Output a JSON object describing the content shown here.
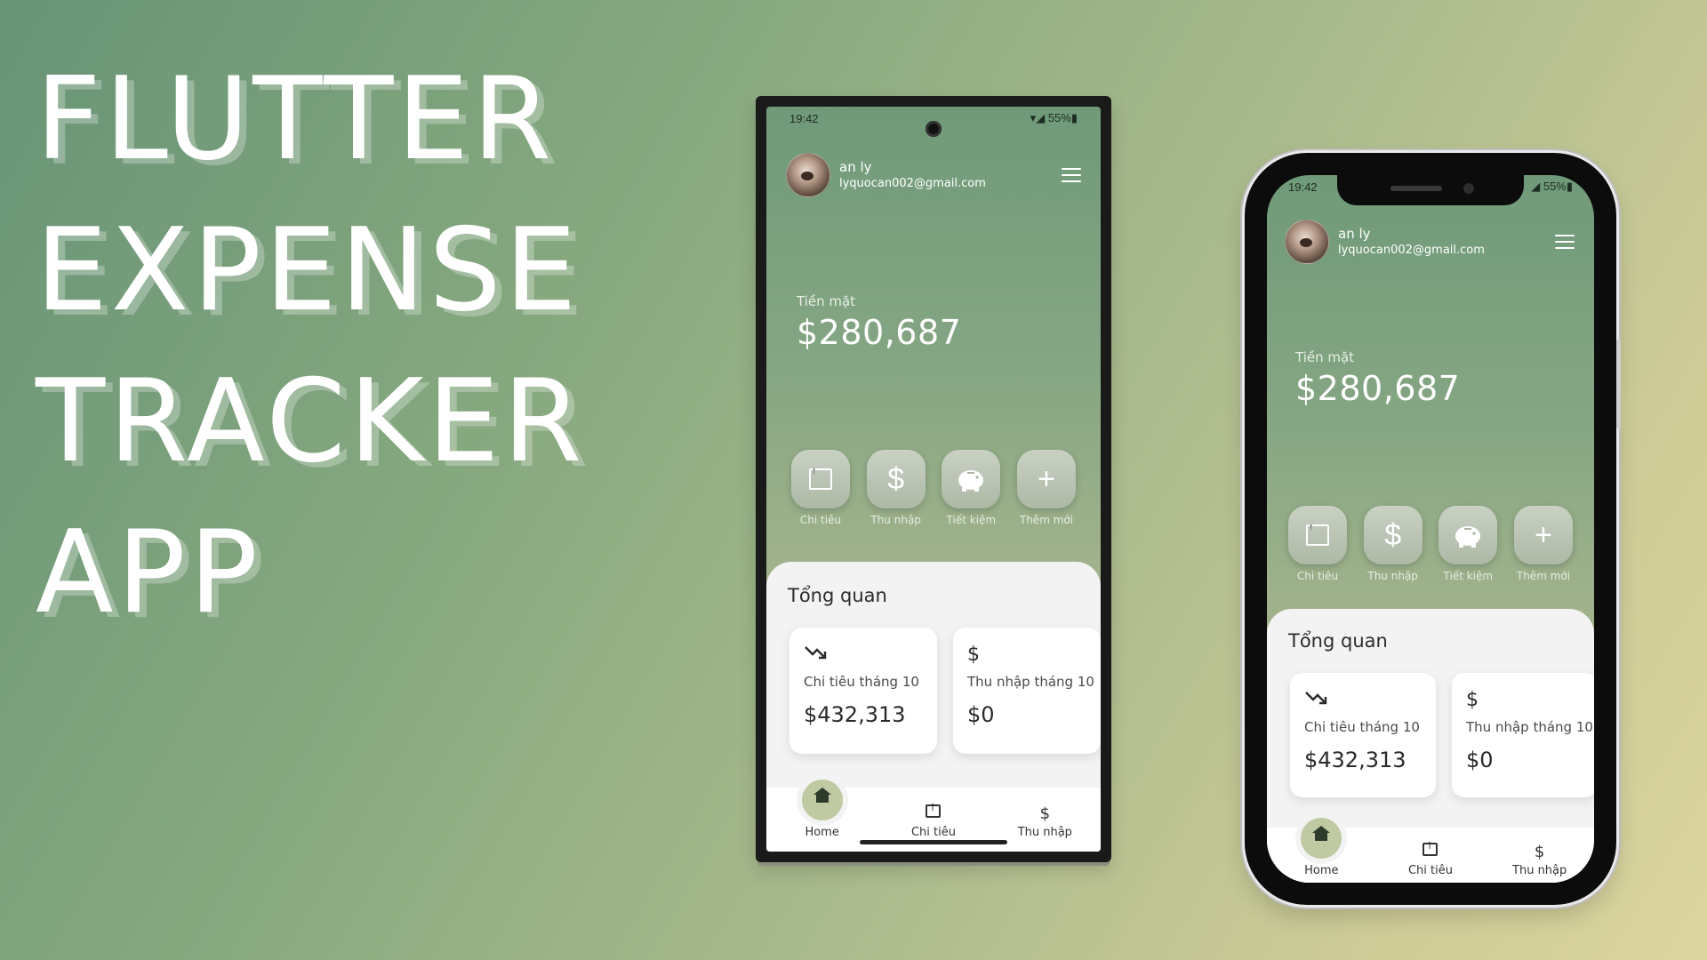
{
  "hero": {
    "line1": "FLUTTER",
    "line2": "EXPENSE",
    "line3": "TRACKER",
    "line4": "APP"
  },
  "phone1": {
    "status_time": "19:42",
    "status_battery": "55%"
  },
  "phone2": {
    "status_time": "19:42",
    "status_battery": "55%"
  },
  "user": {
    "name": "an ly",
    "email": "lyquocan002@gmail.com"
  },
  "balance": {
    "label": "Tiền mặt",
    "value": "$280,687"
  },
  "actions": [
    {
      "label": "Chi tiêu",
      "icon": "tray-upload-icon"
    },
    {
      "label": "Thu nhập",
      "icon": "dollar-icon"
    },
    {
      "label": "Tiết kiệm",
      "icon": "piggy-bank-icon"
    },
    {
      "label": "Thêm mới",
      "icon": "plus-icon"
    }
  ],
  "overview": {
    "title": "Tổng quan",
    "cards": [
      {
        "label": "Chi tiêu tháng 10",
        "value": "$432,313",
        "icon": "trending-down-icon"
      },
      {
        "label": "Thu nhập tháng 10",
        "value": "$0",
        "icon": "dollar-icon"
      }
    ]
  },
  "nav": [
    {
      "label": "Home",
      "icon": "home-icon",
      "active": true
    },
    {
      "label": "Chi tiêu",
      "icon": "tray-upload-icon"
    },
    {
      "label": "Thu nhập",
      "icon": "dollar-icon"
    }
  ],
  "colors": {
    "accent": "#bfcaa2",
    "background_start": "#679476",
    "background_end": "#dbd59e"
  }
}
